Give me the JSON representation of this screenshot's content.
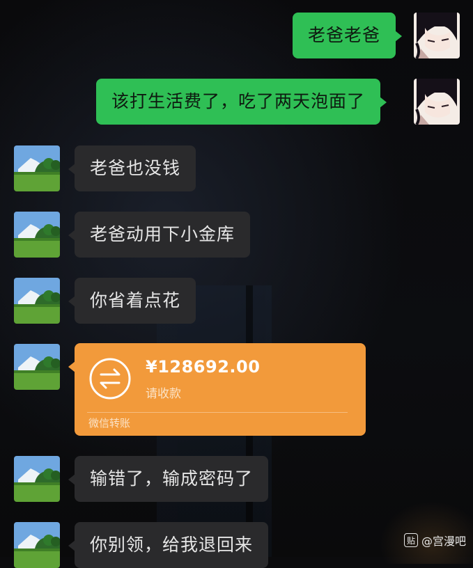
{
  "messages": {
    "m1": "老爸老爸",
    "m2": "该打生活费了，吃了两天泡面了",
    "m3": "老爸也没钱",
    "m4": "老爸动用下小金库",
    "m5": "你省着点花",
    "m7": "输错了，输成密码了",
    "m8": "你别领，给我退回来"
  },
  "transfer": {
    "amount": "¥128692.00",
    "status": "请收款",
    "source": "微信转账",
    "icon": "transfer-arrows-icon",
    "color": "#f29a3b"
  },
  "colors": {
    "sent_bubble": "#2fbf55",
    "received_bubble": "#2a2a2c",
    "background": "#0b0b0d"
  },
  "watermark": {
    "badge": "贴",
    "text": "@宫漫吧"
  }
}
